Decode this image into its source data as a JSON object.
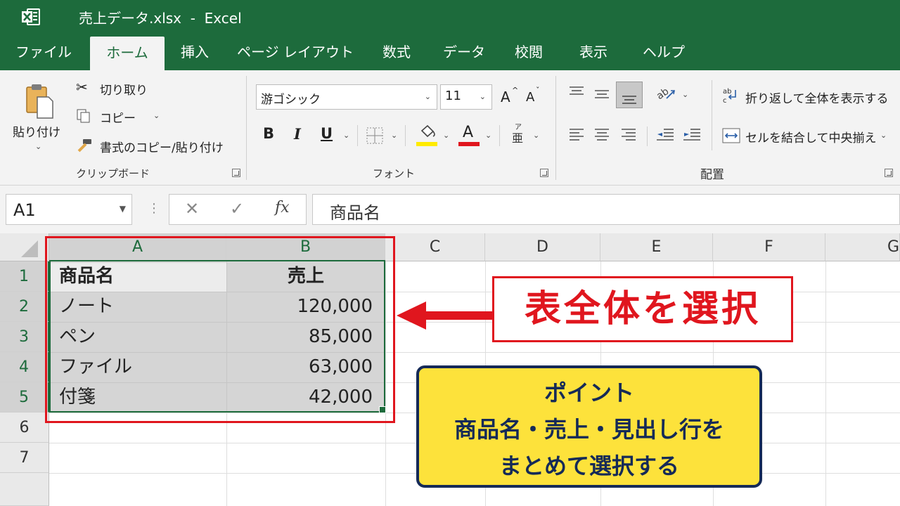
{
  "window": {
    "title": "売上データ.xlsx  -  Excel",
    "app_icon": "excel-icon",
    "colors": {
      "titlebar": "#1d6b3c",
      "accent": "#1d6b3c",
      "ribbon_bg": "#f3f3f3"
    }
  },
  "ribbon_tabs": [
    "ファイル",
    "ホーム",
    "挿入",
    "ページ レイアウト",
    "数式",
    "データ",
    "校閲",
    "表示",
    "ヘルプ"
  ],
  "active_tab": "ホーム",
  "ribbon": {
    "clipboard": {
      "paste_label": "貼り付け",
      "cut_label": "切り取り",
      "copy_label": "コピー",
      "format_painter_label": "書式のコピー/貼り付け",
      "group_label": "クリップボード"
    },
    "font": {
      "font_name": "游ゴシック",
      "font_size": "11",
      "bold": "B",
      "italic": "I",
      "underline": "U",
      "font_color_glyph": "A",
      "grow_glyph": "A",
      "shrink_glyph": "A",
      "highlight_color": "#ffeb00",
      "font_color": "#e0161e",
      "group_label": "フォント"
    },
    "alignment": {
      "wrap_text_label": "折り返して全体を表示する",
      "merge_center_label": "セルを結合して中央揃え",
      "group_label": "配置"
    }
  },
  "formula_bar": {
    "name_box": "A1",
    "fx": "fx",
    "content": "商品名"
  },
  "grid": {
    "columns": [
      "A",
      "B",
      "C",
      "D",
      "E",
      "F",
      "G"
    ],
    "rows": [
      "1",
      "2",
      "3",
      "4",
      "5",
      "6",
      "7"
    ],
    "selected_columns": [
      "A",
      "B"
    ],
    "selected_rows": [
      "1",
      "2",
      "3",
      "4",
      "5"
    ],
    "cells": [
      [
        "商品名",
        "売上"
      ],
      [
        "ノート",
        "120,000"
      ],
      [
        "ペン",
        "85,000"
      ],
      [
        "ファイル",
        "63,000"
      ],
      [
        "付箋",
        "42,000"
      ]
    ]
  },
  "annotations": {
    "select_callout": "表全体を選択",
    "point_title": "ポイント",
    "point_line1": "商品名・売上・見出し行を",
    "point_line2": "まとめて選択する",
    "colors": {
      "red": "#e0161e",
      "navy": "#152a57",
      "yellow": "#fde23b"
    }
  }
}
